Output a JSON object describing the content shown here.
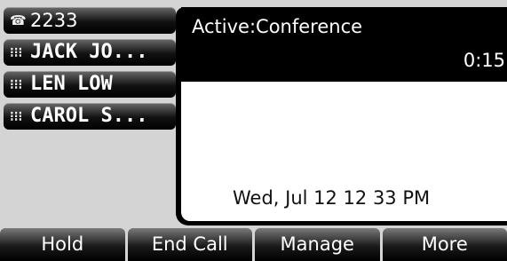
{
  "lines": [
    {
      "icon": "phone-handset-icon",
      "label": "2233"
    },
    {
      "icon": "grid-contact-icon",
      "label": "JACK JO..."
    },
    {
      "icon": "grid-contact-icon",
      "label": "LEN LOW"
    },
    {
      "icon": "grid-contact-icon",
      "label": "CAROL S..."
    }
  ],
  "call": {
    "status": "Active:Conference",
    "timer": "0:15"
  },
  "datetime": "Wed, Jul 12  12 33 PM",
  "softkeys": [
    "Hold",
    "End Call",
    "Manage",
    "More"
  ]
}
